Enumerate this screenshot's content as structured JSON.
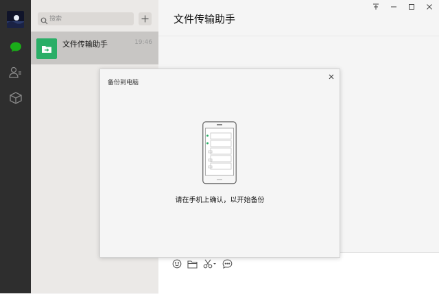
{
  "search": {
    "placeholder": "搜索"
  },
  "chats": [
    {
      "name": "文件传输助手",
      "time": "19:46"
    }
  ],
  "main": {
    "title": "文件传输助手"
  },
  "dialog": {
    "title": "备份到电脑",
    "message": "请在手机上确认，以开始备份"
  },
  "colors": {
    "nav_bg": "#2e2e2e",
    "accent_green": "#2aae67",
    "chat_selected": "#c8c6c4",
    "list_bg": "#ebe9e7"
  }
}
